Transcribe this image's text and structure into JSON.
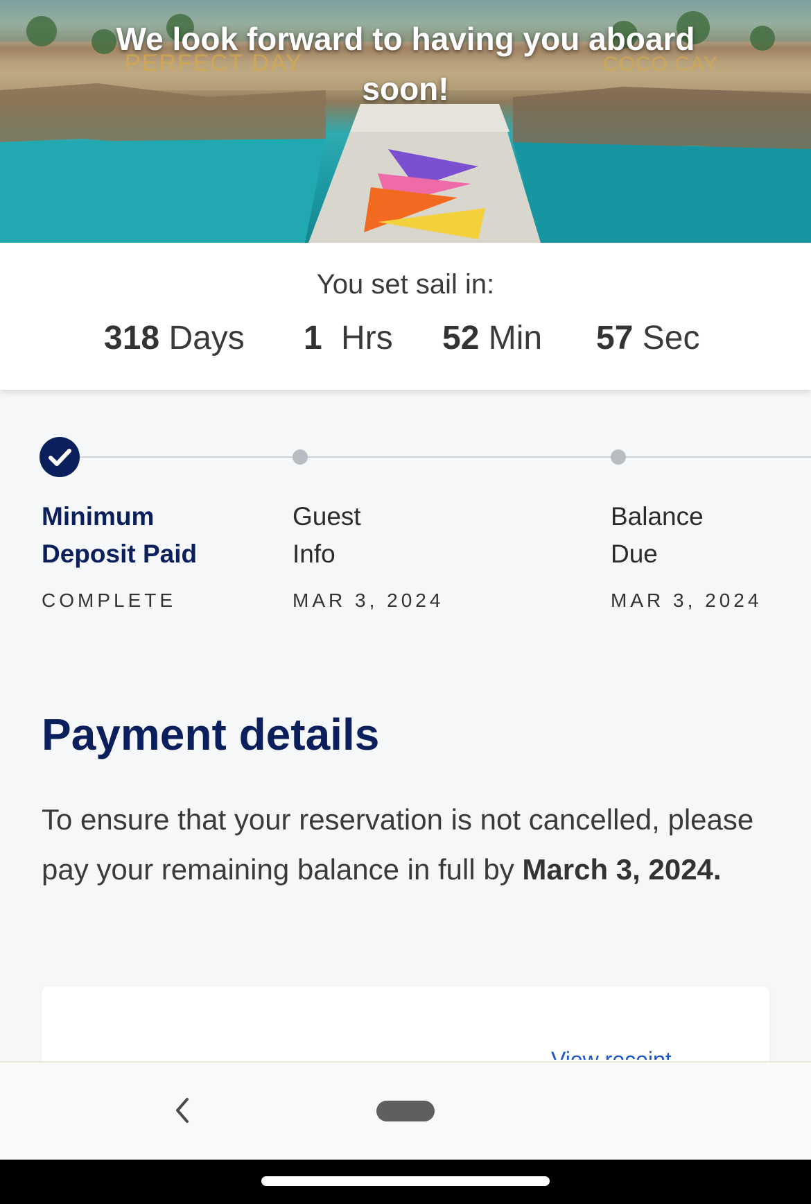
{
  "hero": {
    "title_line1": "We look forward to having you aboard",
    "title_line2": "soon!",
    "sign_left": "PERFECT DAY",
    "sign_right": "COCO CAY"
  },
  "countdown": {
    "label": "You set sail in:",
    "days": "318",
    "days_unit": "Days",
    "hours": "1",
    "hours_unit": "Hrs",
    "minutes": "52",
    "minutes_unit": "Min",
    "seconds": "57",
    "seconds_unit": "Sec"
  },
  "steps": [
    {
      "title_line1": "Minimum",
      "title_line2": "Deposit Paid",
      "status": "COMPLETE",
      "done": true
    },
    {
      "title_line1": "Guest",
      "title_line2": "Info",
      "status": "MAR 3, 2024",
      "done": false
    },
    {
      "title_line1": "Balance",
      "title_line2": "Due",
      "status": "MAR 3, 2024",
      "done": false
    }
  ],
  "payment": {
    "heading": "Payment details",
    "text": "To ensure that your reservation is not cancelled, please pay your remaining balance in full by",
    "deadline": "March 3, 2024.",
    "card_link": "View receipt"
  },
  "colors": {
    "navy": "#0b1f5c",
    "link": "#1a56c9"
  },
  "icons": {
    "check": "check-icon",
    "back": "chevron-left-icon"
  }
}
